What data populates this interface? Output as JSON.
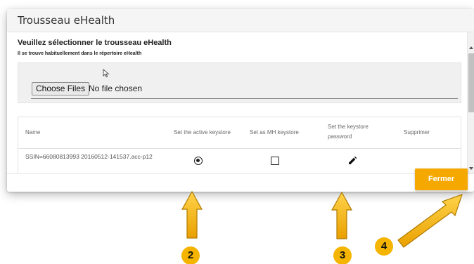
{
  "dialog": {
    "title": "Trousseau eHealth",
    "heading": "Veuillez sélectionner le trousseau eHealth",
    "hint": "Il se trouve habituellement dans le répertoire eHealth",
    "file_input": {
      "button_label": "Choose Files",
      "status": "No file chosen"
    },
    "table": {
      "headers": [
        "Name",
        "Set the active keystore",
        "Set as MH keystore",
        "Set the keystore password",
        "Supprimer"
      ],
      "rows": [
        {
          "name": "SSIN=66080813993 20160512-141537.acc-p12",
          "active": true,
          "mh_keystore": false
        }
      ]
    },
    "close_label": "Fermer"
  },
  "annotations": {
    "badges": [
      "2",
      "3",
      "4"
    ],
    "color": "#F5B400"
  },
  "colors": {
    "accent": "#F5A800",
    "header_bg": "#F5F5F5",
    "file_area_bg": "#F0F0F0"
  },
  "icons": [
    "cursor-icon",
    "radio-selected-icon",
    "checkbox-empty-icon",
    "pencil-icon"
  ]
}
